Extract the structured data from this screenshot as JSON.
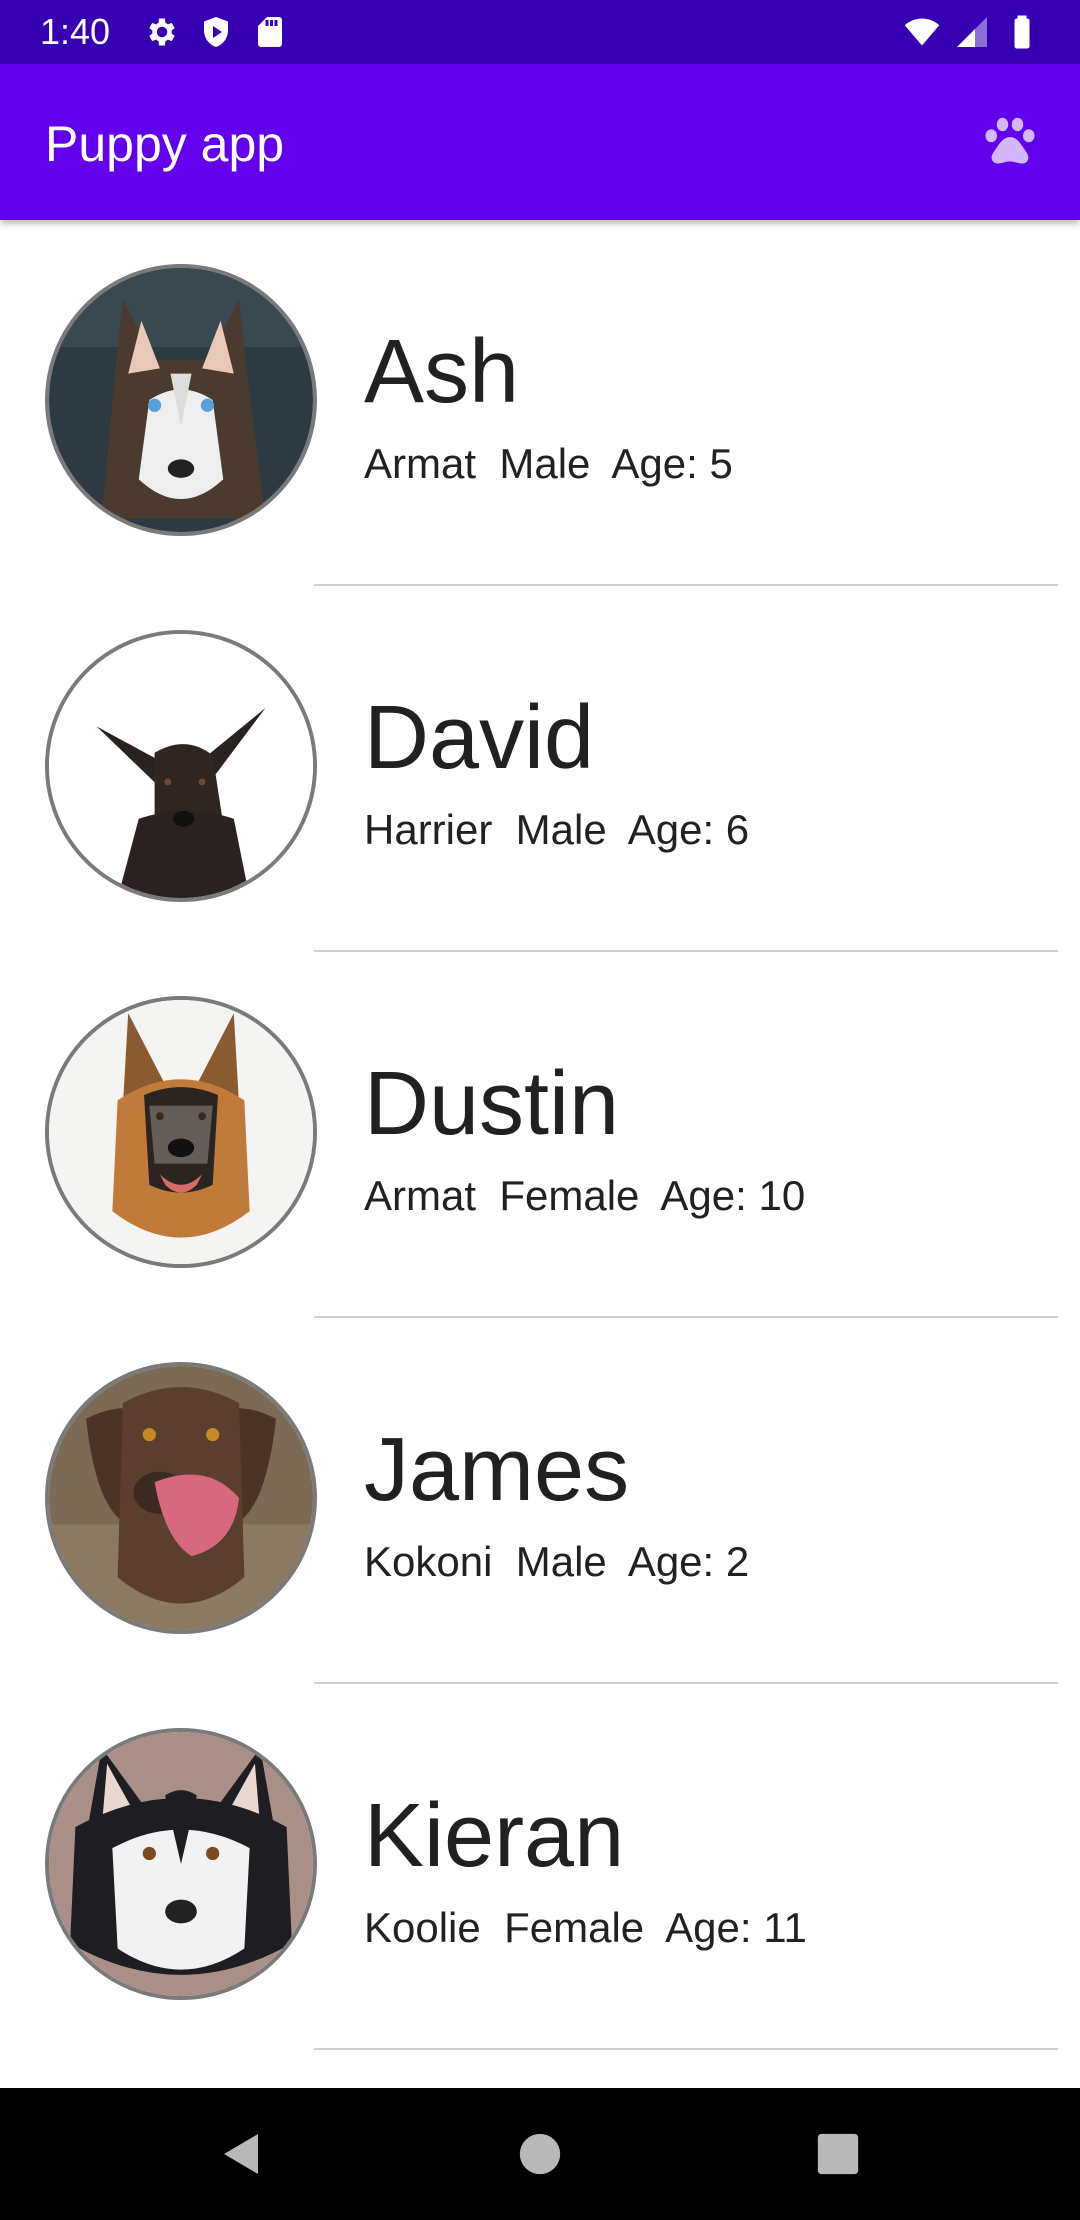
{
  "status_bar": {
    "time": "1:40",
    "left_icons": [
      "gear-icon",
      "shield-icon",
      "sd-card-icon"
    ],
    "right_icons": [
      "wifi-icon",
      "signal-icon",
      "battery-icon"
    ]
  },
  "app_bar": {
    "title": "Puppy app",
    "action_icon": "paw-icon"
  },
  "puppies": [
    {
      "name": "Ash",
      "info": "Armat  Male  Age: 5",
      "photo": "husky-icon"
    },
    {
      "name": "David",
      "info": "Harrier  Male  Age: 6",
      "photo": "black-shepherd-icon"
    },
    {
      "name": "Dustin",
      "info": "Armat  Female  Age: 10",
      "photo": "german-shepherd-icon"
    },
    {
      "name": "James",
      "info": "Kokoni  Male  Age: 2",
      "photo": "chocolate-lab-icon"
    },
    {
      "name": "Kieran",
      "info": "Koolie  Female  Age: 11",
      "photo": "malamute-icon"
    }
  ],
  "nav_bar": {
    "buttons": [
      "back-icon",
      "home-icon",
      "recents-icon"
    ]
  },
  "colors": {
    "status_bar": "#3700b3",
    "app_bar": "#6200ee",
    "paw_icon": "#d4b8ff",
    "text": "#212121",
    "divider": "#d0d0d0",
    "avatar_border": "#7a7a7a"
  }
}
